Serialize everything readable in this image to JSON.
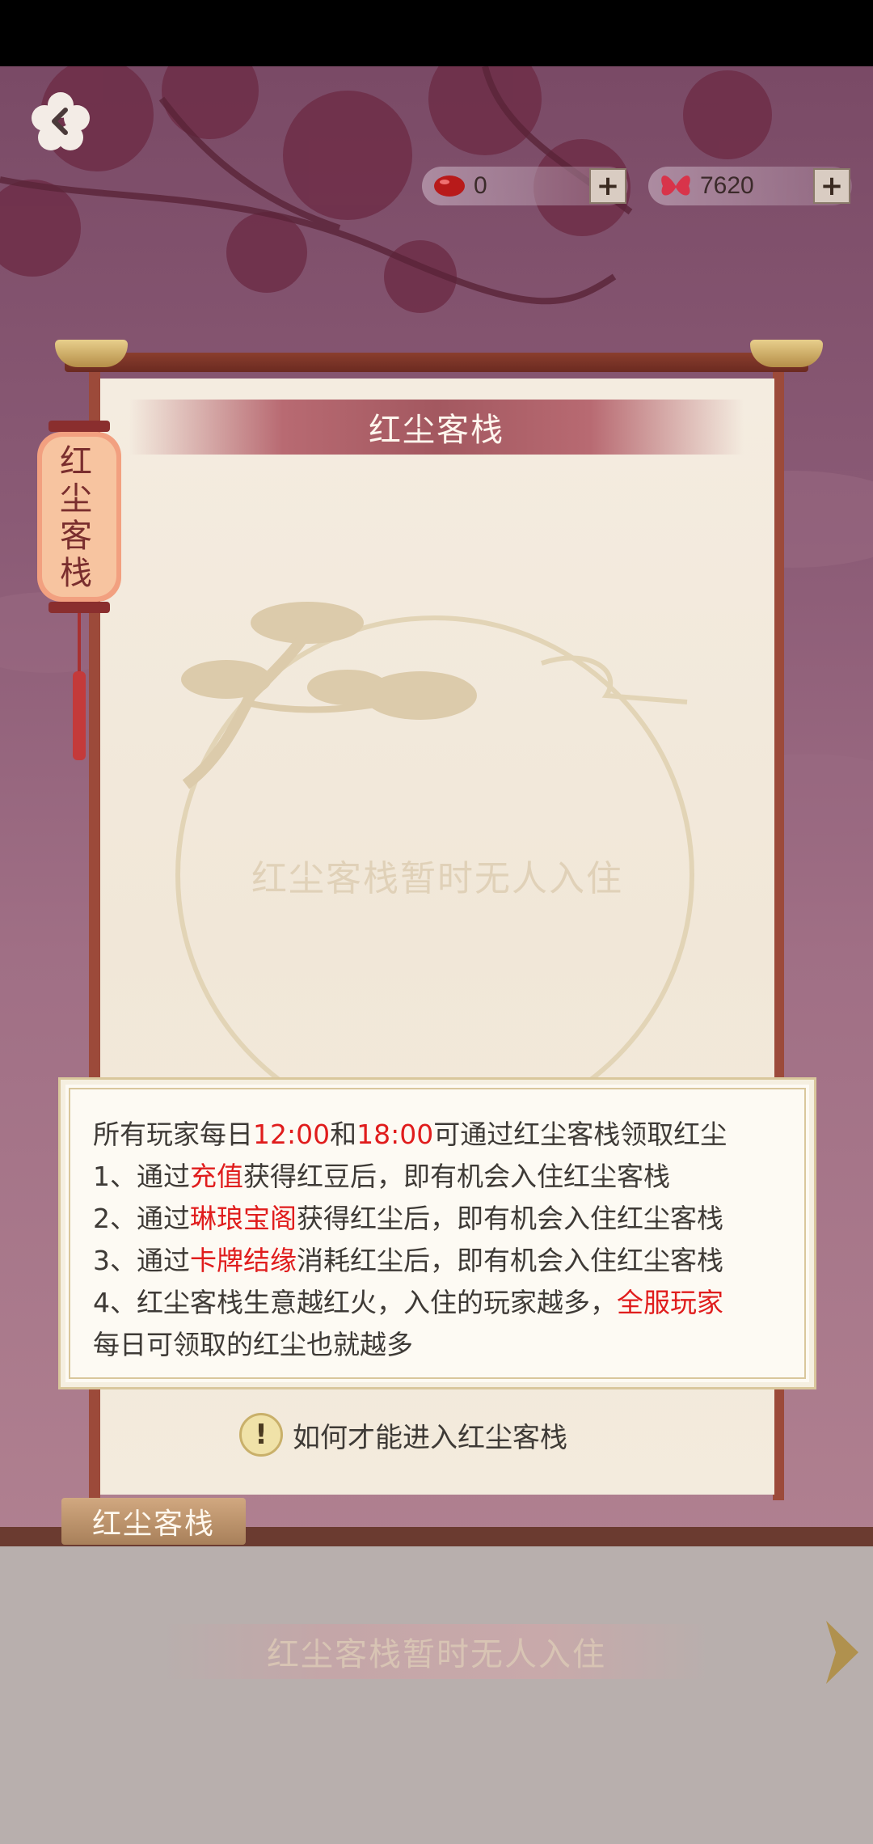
{
  "currencies": {
    "bean": {
      "icon": "red-bean-icon",
      "value": "0"
    },
    "dust": {
      "icon": "butterfly-icon",
      "value": "7620"
    }
  },
  "panel": {
    "title": "红尘客栈",
    "empty_message": "红尘客栈暂时无人入住"
  },
  "lantern": {
    "text": "红尘客栈"
  },
  "info": {
    "line1": {
      "a": "所有玩家每日",
      "b": "12:00",
      "c": "和",
      "d": "18:00",
      "e": "可通过红尘客栈领取红尘"
    },
    "line2": {
      "a": "1、通过",
      "b": "充值",
      "c": "获得红豆后，即有机会入住红尘客栈"
    },
    "line3": {
      "a": "2、通过",
      "b": "琳琅宝阁",
      "c": "获得红尘后，即有机会入住红尘客栈"
    },
    "line4": {
      "a": "3、通过",
      "b": "卡牌结缘",
      "c": "消耗红尘后，即有机会入住红尘客栈"
    },
    "line5": {
      "a": "4、红尘客栈生意越红火，入住的玩家越多，",
      "b": "全服玩家"
    },
    "line6": "每日可领取的红尘也就越多"
  },
  "hint": {
    "icon_text": "!",
    "label": "如何才能进入红尘客栈"
  },
  "tag": {
    "label": "红尘客栈"
  },
  "bottom": {
    "message": "红尘客栈暂时无人入住"
  },
  "colors": {
    "highlight": "#e01c1c",
    "panel": "#f3ebdd",
    "frame": "#9c4a3a"
  }
}
